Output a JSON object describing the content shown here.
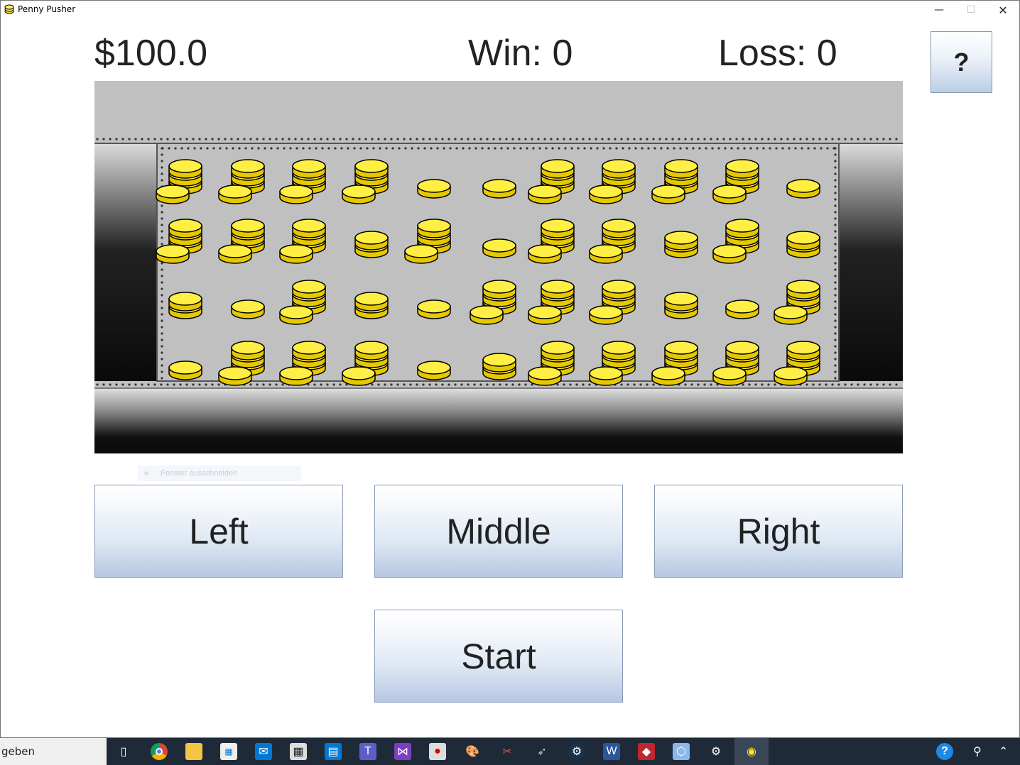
{
  "window": {
    "title": "Penny Pusher",
    "controls": {
      "minimize": "—",
      "maximize": "☐",
      "close": "✕"
    }
  },
  "stats": {
    "money": "$100.0",
    "win": "Win: 0",
    "loss": "Loss: 0"
  },
  "help_button": "?",
  "ghost_tooltip": "Fenster ausschneiden",
  "buttons": {
    "left": "Left",
    "middle": "Middle",
    "right": "Right",
    "start": "Start"
  },
  "board": {
    "coin_color": "#ffee44",
    "coin_shade": "#e6c800",
    "outline": "#000000",
    "tray_color": "#c0c0c0",
    "rows": [
      [
        3,
        3,
        3,
        3,
        1,
        1,
        3,
        3,
        3,
        3,
        1
      ],
      [
        3,
        3,
        3,
        2,
        3,
        1,
        3,
        3,
        2,
        3,
        2
      ],
      [
        2,
        1,
        3,
        2,
        1,
        3,
        3,
        3,
        2,
        1,
        3
      ],
      [
        1,
        3,
        3,
        3,
        1,
        2,
        4,
        3,
        3,
        3,
        3
      ]
    ]
  },
  "taskbar": {
    "search_text": "geben",
    "icons": [
      "task-view-icon",
      "chrome-icon",
      "file-explorer-icon",
      "store-icon",
      "mail-icon",
      "calculator-icon",
      "calendar-icon",
      "teams-icon",
      "visual-studio-icon",
      "remote-icon",
      "paint-icon",
      "snipping-icon",
      "cursor-icon",
      "steam-icon",
      "word-icon",
      "app-icon",
      "cube-icon",
      "settings-icon",
      "penny-pusher-icon"
    ]
  }
}
